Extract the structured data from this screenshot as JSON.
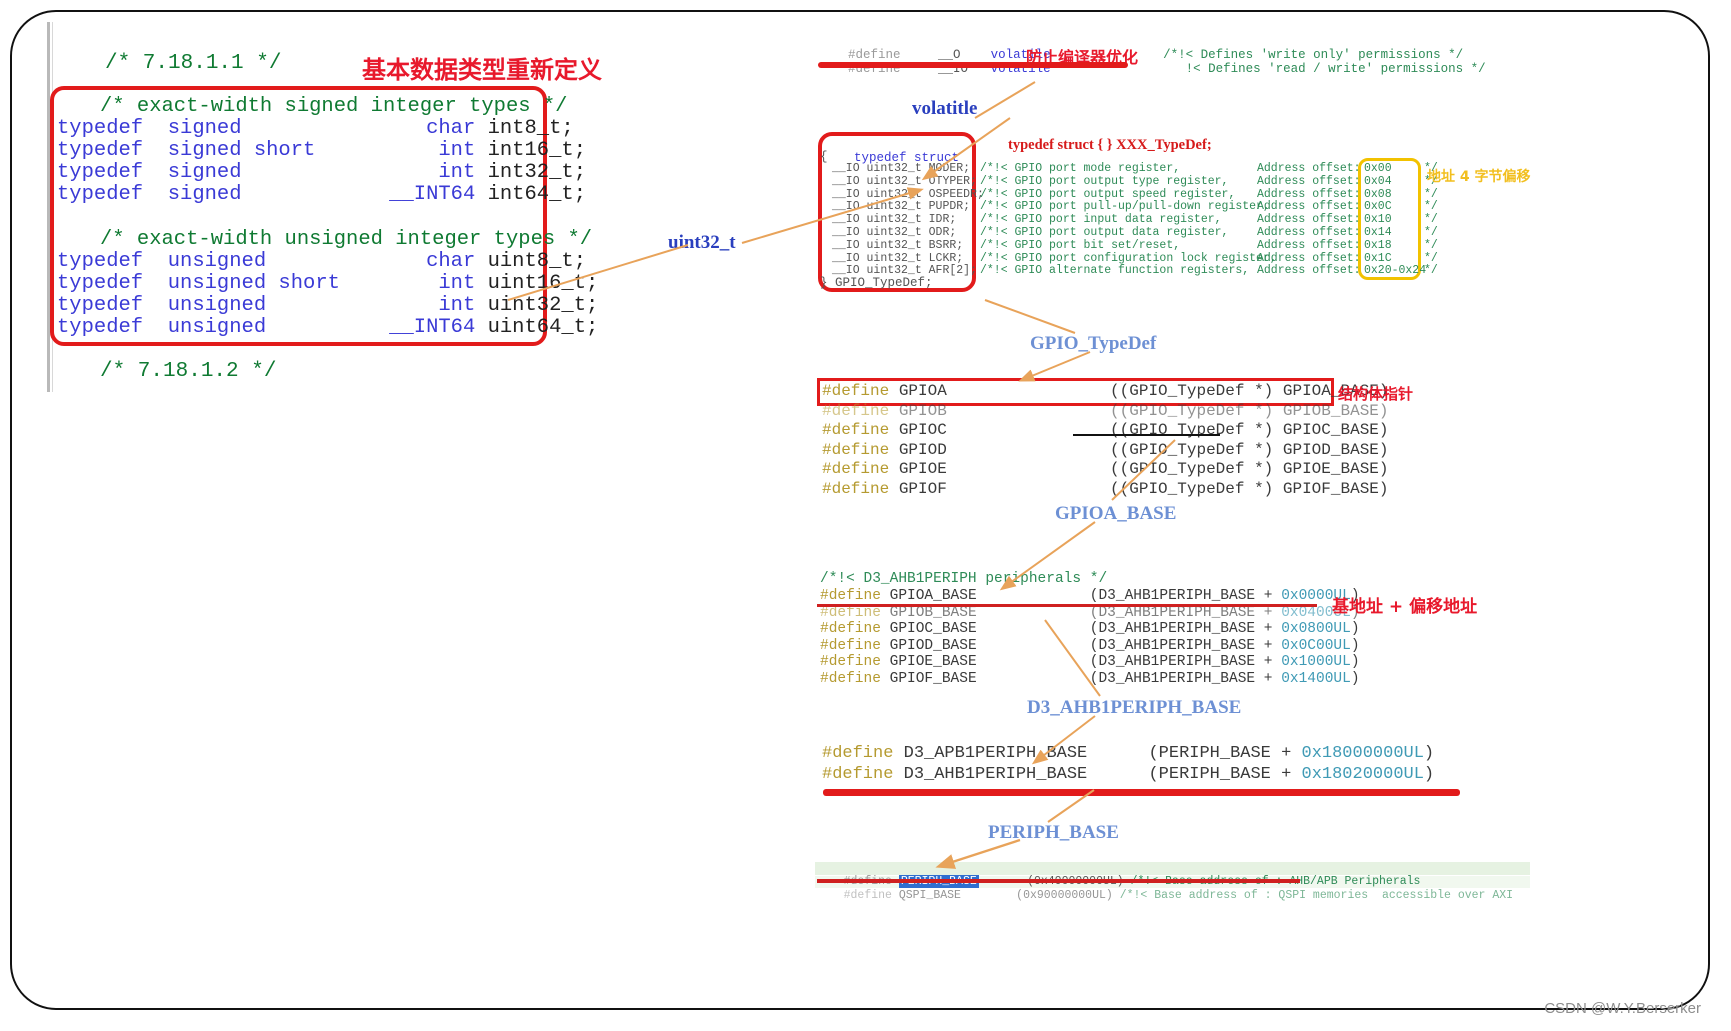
{
  "left_panel": {
    "header_comment": "/* 7.18.1.1 */",
    "footer_comment": "/* 7.18.1.2 */",
    "title_annotation": "基本数据类型重新定义",
    "signed_comment": "/* exact-width signed integer types */",
    "unsigned_comment": "/* exact-width unsigned integer types */",
    "signed_typedefs": [
      {
        "kw": "typedef",
        "sign": "signed",
        "base": "char",
        "name": "int8_t;"
      },
      {
        "kw": "typedef",
        "sign": "signed short",
        "base": "int",
        "name": "int16_t;"
      },
      {
        "kw": "typedef",
        "sign": "signed",
        "base": "int",
        "name": "int32_t;"
      },
      {
        "kw": "typedef",
        "sign": "signed",
        "base": "__INT64",
        "name": "int64_t;"
      }
    ],
    "unsigned_typedefs": [
      {
        "kw": "typedef",
        "sign": "unsigned",
        "base": "char",
        "name": "uint8_t;"
      },
      {
        "kw": "typedef",
        "sign": "unsigned short",
        "base": "int",
        "name": "uint16_t;"
      },
      {
        "kw": "typedef",
        "sign": "unsigned",
        "base": "int",
        "name": "uint32_t;"
      },
      {
        "kw": "typedef",
        "sign": "unsigned",
        "base": "__INT64",
        "name": "uint64_t;"
      }
    ]
  },
  "volatile_block": {
    "lines": [
      {
        "hash": "#define",
        "name": "__O",
        "value": "volatile",
        "comment": "/*!< Defines 'write only' permissions */"
      },
      {
        "hash": "#define",
        "name": "__IO",
        "value": "volatile",
        "comment": "!< Defines 'read / write' permissions */"
      }
    ],
    "annotation": "防止编译器优化",
    "callout": "volatitle"
  },
  "struct_block": {
    "header": "typedef struct",
    "open_brace": "{",
    "close": "} GPIO_TypeDef;",
    "title_annotation": "typedef struct { } XXX_TypeDef;",
    "offset_annotation": "地址 4 字节偏移",
    "callout": "uint32_t",
    "members": [
      {
        "qual": "__IO",
        "type": "uint32_t",
        "name": "MODER;",
        "comment": "/*!< GPIO port mode register,",
        "addr_label": "Address offset:",
        "offset": "0x00",
        "tail": "*/"
      },
      {
        "qual": "__IO",
        "type": "uint32_t",
        "name": "OTYPER;",
        "comment": "/*!< GPIO port output type register,",
        "addr_label": "Address offset:",
        "offset": "0x04",
        "tail": "*/"
      },
      {
        "qual": "__IO",
        "type": "uint32_t",
        "name": "OSPEEDR;",
        "comment": "/*!< GPIO port output speed register,",
        "addr_label": "Address offset:",
        "offset": "0x08",
        "tail": "*/"
      },
      {
        "qual": "__IO",
        "type": "uint32_t",
        "name": "PUPDR;",
        "comment": "/*!< GPIO port pull-up/pull-down register,",
        "addr_label": "Address offset:",
        "offset": "0x0C",
        "tail": "*/"
      },
      {
        "qual": "__IO",
        "type": "uint32_t",
        "name": "IDR;",
        "comment": "/*!< GPIO port input data register,",
        "addr_label": "Address offset:",
        "offset": "0x10",
        "tail": "*/"
      },
      {
        "qual": "__IO",
        "type": "uint32_t",
        "name": "ODR;",
        "comment": "/*!< GPIO port output data register,",
        "addr_label": "Address offset:",
        "offset": "0x14",
        "tail": "*/"
      },
      {
        "qual": "__IO",
        "type": "uint32_t",
        "name": "BSRR;",
        "comment": "/*!< GPIO port bit set/reset,",
        "addr_label": "Address offset:",
        "offset": "0x18",
        "tail": "*/"
      },
      {
        "qual": "__IO",
        "type": "uint32_t",
        "name": "LCKR;",
        "comment": "/*!< GPIO port configuration lock register,",
        "addr_label": "Address offset:",
        "offset": "0x1C",
        "tail": "*/"
      },
      {
        "qual": "__IO",
        "type": "uint32_t",
        "name": "AFR[2];",
        "comment": "/*!< GPIO alternate function registers,",
        "addr_label": "Address offset:",
        "offset": "0x20-0x24",
        "tail": "*/"
      }
    ]
  },
  "gpio_defines": {
    "callout": "GPIO_TypeDef",
    "annotation": "结构体指针",
    "lines": [
      {
        "hash": "#define",
        "name": "GPIOA",
        "value": "((GPIO_TypeDef *) GPIOA_BASE)"
      },
      {
        "hash": "#define",
        "name": "GPIOB",
        "value": "((GPIO_TypeDef *) GPIOB_BASE)"
      },
      {
        "hash": "#define",
        "name": "GPIOC",
        "value": "((GPIO_TypeDef *) GPIOC_BASE)"
      },
      {
        "hash": "#define",
        "name": "GPIOD",
        "value": "((GPIO_TypeDef *) GPIOD_BASE)"
      },
      {
        "hash": "#define",
        "name": "GPIOE",
        "value": "((GPIO_TypeDef *) GPIOE_BASE)"
      },
      {
        "hash": "#define",
        "name": "GPIOF",
        "value": "((GPIO_TypeDef *) GPIOF_BASE)"
      }
    ]
  },
  "base_defines": {
    "callout": "GPIOA_BASE",
    "section_comment": "/*!< D3_AHB1PERIPH peripherals */",
    "annotation": "基地址 + 偏移地址",
    "lines": [
      {
        "hash": "#define",
        "name": "GPIOA_BASE",
        "prefix": "(D3_AHB1PERIPH_BASE + ",
        "offset": "0x0000UL",
        "suffix": ")"
      },
      {
        "hash": "#define",
        "name": "GPIOB_BASE",
        "prefix": "(D3_AHB1PERIPH_BASE + ",
        "offset": "0x0400UL",
        "suffix": ")"
      },
      {
        "hash": "#define",
        "name": "GPIOC_BASE",
        "prefix": "(D3_AHB1PERIPH_BASE + ",
        "offset": "0x0800UL",
        "suffix": ")"
      },
      {
        "hash": "#define",
        "name": "GPIOD_BASE",
        "prefix": "(D3_AHB1PERIPH_BASE + ",
        "offset": "0x0C00UL",
        "suffix": ")"
      },
      {
        "hash": "#define",
        "name": "GPIOE_BASE",
        "prefix": "(D3_AHB1PERIPH_BASE + ",
        "offset": "0x1000UL",
        "suffix": ")"
      },
      {
        "hash": "#define",
        "name": "GPIOF_BASE",
        "prefix": "(D3_AHB1PERIPH_BASE + ",
        "offset": "0x1400UL",
        "suffix": ")"
      }
    ]
  },
  "periph_defines": {
    "callout": "D3_AHB1PERIPH_BASE",
    "lines": [
      {
        "hash": "#define",
        "name": "D3_APB1PERIPH_BASE",
        "prefix": "(PERIPH_BASE + ",
        "offset": "0x18000000UL",
        "suffix": ")"
      },
      {
        "hash": "#define",
        "name": "D3_AHB1PERIPH_BASE",
        "prefix": "(PERIPH_BASE + ",
        "offset": "0x18020000UL",
        "suffix": ")"
      }
    ]
  },
  "periph_base_block": {
    "callout": "PERIPH_BASE",
    "lines": [
      {
        "hash": "#define",
        "name": "PERIPH_BASE",
        "value": "(0x40000000UL)",
        "comment": "/*!< Base address of : AHB/APB Peripherals"
      },
      {
        "hash": "#define",
        "name": "QSPI_BASE",
        "value": "(0x90000000UL)",
        "comment": "/*!< Base address of : QSPI memories  accessible over AXI"
      }
    ]
  },
  "watermark": "CSDN @W.Y.Berserker",
  "colors": {
    "red": "#e21b1b",
    "yellow": "#f2c200",
    "blue_label": "#6d90d4",
    "keyword_blue": "#3a3ad6",
    "comment_green": "#2e8b57",
    "number_teal": "#3f9ab5"
  }
}
